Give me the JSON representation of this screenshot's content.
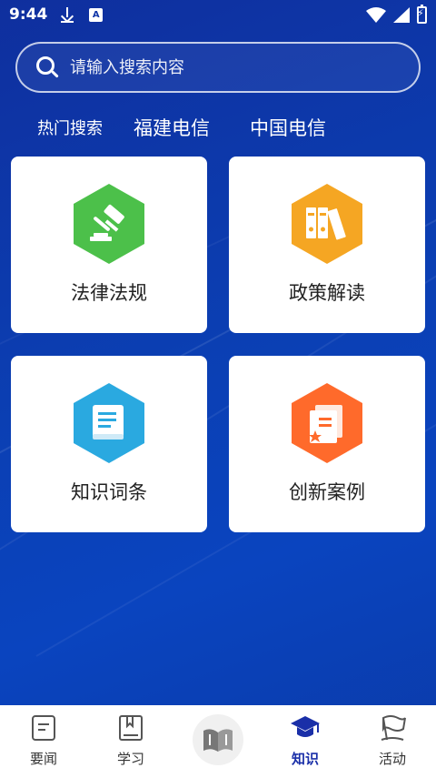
{
  "status_bar": {
    "time": "9:44",
    "a_badge": "A"
  },
  "search": {
    "placeholder": "请输入搜索内容"
  },
  "hot_search": {
    "label": "热门搜索",
    "tags": [
      "福建电信",
      "中国电信"
    ]
  },
  "cards": [
    {
      "title": "法律法规",
      "icon": "gavel-icon",
      "color": "#4cc04a"
    },
    {
      "title": "政策解读",
      "icon": "binders-icon",
      "color": "#f5a623"
    },
    {
      "title": "知识词条",
      "icon": "book-icon",
      "color": "#2aa9e0"
    },
    {
      "title": "创新案例",
      "icon": "certificate-icon",
      "color": "#ff6a2b"
    }
  ],
  "nav": {
    "items": [
      {
        "label": "要闻",
        "icon": "news-doc-icon"
      },
      {
        "label": "学习",
        "icon": "study-book-icon"
      },
      {
        "label": "",
        "icon": "open-book-icon"
      },
      {
        "label": "知识",
        "icon": "graduation-cap-icon"
      },
      {
        "label": "活动",
        "icon": "flag-icon"
      }
    ],
    "active": "知识",
    "active_color": "#1a2fa8"
  }
}
